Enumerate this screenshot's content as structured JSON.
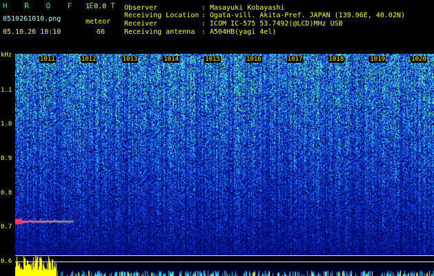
{
  "header": {
    "brand": "H R O F F T",
    "version": "1.0.0",
    "filename": "0510261010.png",
    "datetime": "05.10.26 10:10",
    "meteor_label": "meteor",
    "meteor_count": "66",
    "observer_label": "Observer",
    "observer_value": ": Masayuki Kobayashi",
    "location_label": "Receiving Location",
    "location_value": ": Ogata-vill. Akita-Pref. JAPAN (139.96E, 40.02N)",
    "receiver_label": "Receiver",
    "receiver_value": ": ICOM IC-575 53.7492(@LCD)MHz USB",
    "antenna_label": "Receiving antenna",
    "antenna_value": ": A504HB(yagi 4el)"
  },
  "axis": {
    "unit": "kHz",
    "y_ticks": [
      "1.1",
      "1.0",
      "0.9",
      "0.8",
      "0.7",
      "0.6"
    ],
    "x_ticks": [
      "1011",
      "1012",
      "1013",
      "1014",
      "1015",
      "1016",
      "1017",
      "1018",
      "1019",
      "1020"
    ]
  },
  "colors": {
    "background": "#000000",
    "noise_low": "#001a66",
    "noise_mid": "#2255ff",
    "noise_high": "#66ffaa",
    "label": "#ffff00"
  }
}
